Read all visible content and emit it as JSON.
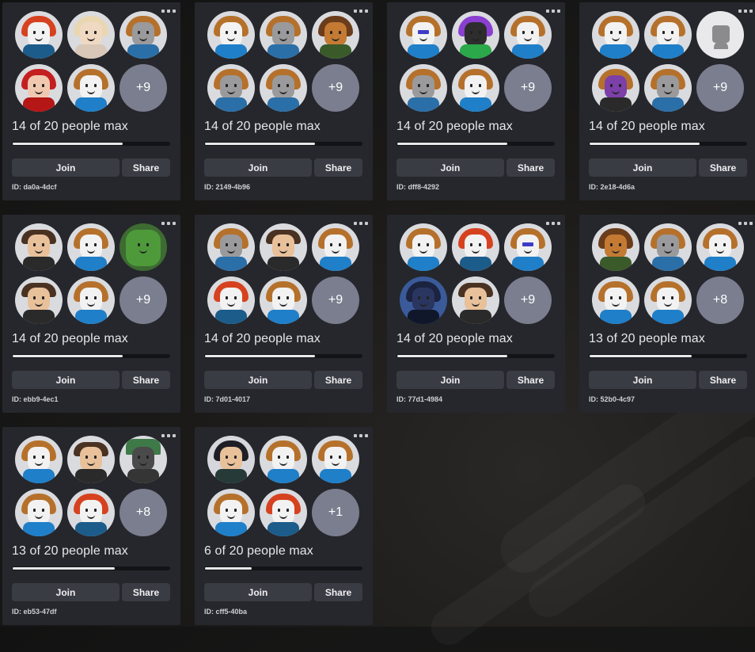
{
  "labels": {
    "join": "Join",
    "share": "Share"
  },
  "servers": [
    {
      "avatars": [
        "red",
        "blonde",
        "gray",
        "devil",
        "default",
        "more"
      ],
      "more_label": "+9",
      "players_text": "14 of 20 people max",
      "players": 14,
      "max": 20,
      "id_text": "ID: da0a-4dcf"
    },
    {
      "avatars": [
        "default",
        "gray",
        "tan",
        "gray",
        "gray",
        "more"
      ],
      "more_label": "+9",
      "players_text": "14 of 20 people max",
      "players": 14,
      "max": 20,
      "id_text": "ID: 2149-4b96"
    },
    {
      "avatars": [
        "glasses",
        "party",
        "default",
        "gray",
        "default",
        "more"
      ],
      "more_label": "+9",
      "players_text": "14 of 20 people max",
      "players": 14,
      "max": 20,
      "id_text": "ID: dff8-4292"
    },
    {
      "avatars": [
        "default",
        "default",
        "wolf",
        "purple",
        "gray",
        "more"
      ],
      "more_label": "+9",
      "players_text": "14 of 20 people max",
      "players": 14,
      "max": 20,
      "id_text": "ID: 2e18-4d6a"
    },
    {
      "avatars": [
        "man",
        "default",
        "green",
        "man",
        "default",
        "more"
      ],
      "more_label": "+9",
      "players_text": "14 of 20 people max",
      "players": 14,
      "max": 20,
      "id_text": "ID: ebb9-4ec1"
    },
    {
      "avatars": [
        "gray",
        "man",
        "default",
        "red",
        "default",
        "more"
      ],
      "more_label": "+9",
      "players_text": "14 of 20 people max",
      "players": 14,
      "max": 20,
      "id_text": "ID: 7d01-4017"
    },
    {
      "avatars": [
        "default",
        "red",
        "glasses",
        "robot",
        "man",
        "more"
      ],
      "more_label": "+9",
      "players_text": "14 of 20 people max",
      "players": 14,
      "max": 20,
      "id_text": "ID: 77d1-4984"
    },
    {
      "avatars": [
        "tan",
        "gray",
        "default",
        "default",
        "default",
        "more"
      ],
      "more_label": "+8",
      "players_text": "13 of 20 people max",
      "players": 13,
      "max": 20,
      "id_text": "ID: 52b0-4c97"
    },
    {
      "avatars": [
        "default",
        "man",
        "cap",
        "default",
        "red",
        "more"
      ],
      "more_label": "+8",
      "players_text": "13 of 20 people max",
      "players": 13,
      "max": 20,
      "id_text": "ID: eb53-47df"
    },
    {
      "avatars": [
        "dark",
        "default",
        "default",
        "default",
        "red",
        "more"
      ],
      "more_label": "+1",
      "players_text": "6 of 20 people max",
      "players": 6,
      "max": 20,
      "id_text": "ID: cff5-40ba"
    }
  ]
}
